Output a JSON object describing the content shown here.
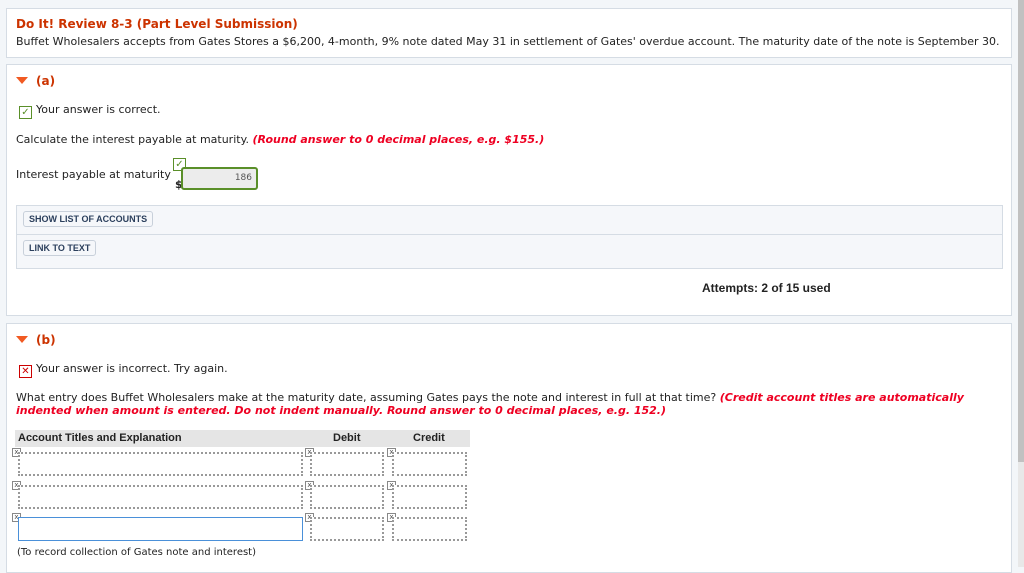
{
  "header": {
    "title": "Do It! Review 8-3 (Part Level Submission)",
    "problem": "Buffet Wholesalers accepts from Gates Stores a $6,200, 4-month, 9% note dated May 31 in settlement of Gates' overdue account. The maturity date of the note is September 30."
  },
  "part_a": {
    "label": "(a)",
    "status": "Your answer is correct.",
    "instruction": "Calculate the interest payable at maturity.",
    "hint": "(Round answer to 0 decimal places, e.g. $155.)",
    "field_label": "Interest payable at maturity",
    "currency": "$",
    "value": "186",
    "show_accounts": "SHOW LIST OF ACCOUNTS",
    "link_text": "LINK TO TEXT",
    "attempts": "Attempts: 2 of 15 used"
  },
  "part_b": {
    "label": "(b)",
    "status": "Your answer is incorrect.  Try again.",
    "instruction": "What entry does Buffet Wholesalers make at the maturity date, assuming Gates pays the note and interest in full at that time?",
    "hint": "(Credit account titles are automatically indented when amount is entered. Do not indent manually. Round answer to 0 decimal places, e.g. 152.)",
    "columns": [
      "Account Titles and Explanation",
      "Debit",
      "Credit"
    ],
    "rows": [
      {
        "account": "",
        "debit": "",
        "credit": ""
      },
      {
        "account": "",
        "debit": "",
        "credit": ""
      },
      {
        "account": "",
        "debit": "",
        "credit": ""
      }
    ],
    "explanation": "(To record collection of Gates note and interest)"
  }
}
